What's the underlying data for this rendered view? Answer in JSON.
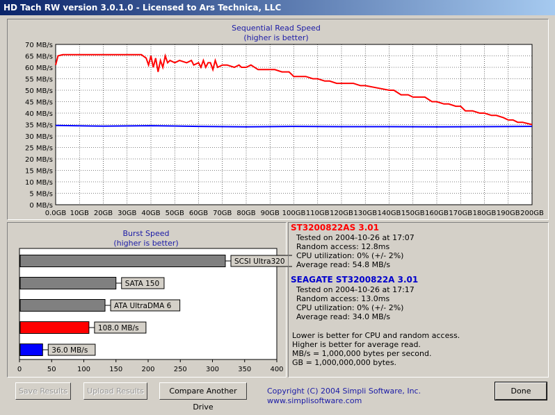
{
  "window": {
    "title": "HD Tach RW version 3.0.1.0 - Licensed to Ars Technica, LLC"
  },
  "seq_chart": {
    "title": "Sequential Read Speed",
    "subtitle": "(higher is better)",
    "y_ticks": [
      "70 MB/s",
      "65 MB/s",
      "60 MB/s",
      "55 MB/s",
      "50 MB/s",
      "45 MB/s",
      "40 MB/s",
      "35 MB/s",
      "30 MB/s",
      "25 MB/s",
      "20 MB/s",
      "15 MB/s",
      "10 MB/s",
      "5 MB/s",
      "0 MB/s"
    ],
    "x_ticks": [
      "0.0GB",
      "10GB",
      "20GB",
      "30GB",
      "40GB",
      "50GB",
      "60GB",
      "70GB",
      "80GB",
      "90GB",
      "100GB",
      "110GB",
      "120GB",
      "130GB",
      "140GB",
      "150GB",
      "160GB",
      "170GB",
      "180GB",
      "190GB",
      "200GB"
    ]
  },
  "burst_chart": {
    "title": "Burst Speed",
    "subtitle": "(higher is better)",
    "x_ticks": [
      "0",
      "50",
      "100",
      "150",
      "200",
      "250",
      "300",
      "350",
      "400"
    ]
  },
  "chart_data": [
    {
      "type": "line",
      "title": "Sequential Read Speed",
      "subtitle": "(higher is better)",
      "xlim": [
        0,
        200
      ],
      "ylim": [
        0,
        70
      ],
      "grid": true,
      "series": [
        {
          "color": "#ff0000",
          "x": [
            0,
            1,
            3,
            10,
            20,
            30,
            36,
            38,
            39,
            40,
            41,
            42,
            43,
            44,
            45,
            46,
            47,
            48,
            50,
            52,
            55,
            57,
            58,
            60,
            61,
            62,
            63,
            64,
            65,
            66,
            67,
            68,
            70,
            72,
            75,
            77,
            78,
            80,
            82,
            85,
            88,
            90,
            92,
            95,
            98,
            100,
            103,
            105,
            108,
            110,
            113,
            115,
            118,
            120,
            125,
            128,
            130,
            135,
            140,
            142,
            145,
            148,
            150,
            152,
            155,
            158,
            160,
            163,
            165,
            168,
            170,
            172,
            175,
            178,
            180,
            183,
            185,
            188,
            190,
            192,
            194,
            196,
            198,
            200
          ],
          "y": [
            61,
            65,
            65.5,
            65.5,
            65.5,
            65.5,
            65.5,
            64,
            61,
            65,
            60,
            64,
            58,
            63,
            60,
            65,
            62,
            63,
            62,
            63,
            62,
            63,
            61,
            62,
            60,
            63,
            60,
            62,
            62,
            59,
            63,
            60,
            61,
            61,
            60,
            61,
            60,
            60,
            61,
            59,
            59,
            59,
            59,
            58,
            58,
            56,
            56,
            56,
            55,
            55,
            54,
            54,
            53,
            53,
            53,
            52,
            52,
            51,
            50,
            50,
            48,
            48,
            47,
            47,
            47,
            45,
            45,
            44,
            44,
            43,
            43,
            41,
            41,
            40,
            40,
            39,
            39,
            38,
            37,
            37,
            36,
            36,
            35.5,
            35
          ]
        },
        {
          "color": "#0000ff",
          "x": [
            0,
            20,
            40,
            60,
            80,
            100,
            120,
            140,
            160,
            180,
            200
          ],
          "y": [
            34.6,
            34.3,
            34.5,
            34.2,
            34.0,
            34.2,
            34.1,
            34.1,
            34.0,
            34.1,
            34.2
          ]
        }
      ]
    },
    {
      "type": "bar",
      "title": "Burst Speed",
      "subtitle": "(higher is better)",
      "categories": [
        "SCSI Ultra320",
        "SATA 150",
        "ATA UltraDMA 6",
        "108.0 MB/s",
        "36.0 MB/s"
      ],
      "values": [
        320,
        150,
        133,
        108,
        36
      ],
      "colors": [
        "#808080",
        "#808080",
        "#808080",
        "#ff0000",
        "#0000ff"
      ],
      "xlim": [
        0,
        400
      ]
    }
  ],
  "results": [
    {
      "name": "ST3200822AS  3.01",
      "color": "#ff0000",
      "lines": [
        "Tested on 2004-10-26 at 17:07",
        "Random access: 12.8ms",
        "CPU utilization: 0% (+/- 2%)",
        "Average read: 54.8 MB/s"
      ]
    },
    {
      "name": "SEAGATE ST3200822A  3.01",
      "color": "#0000cc",
      "lines": [
        "Tested on 2004-10-26 at 17:17",
        "Random access: 13.0ms",
        "CPU utilization: 0% (+/- 2%)",
        "Average read: 34.0 MB/s"
      ]
    }
  ],
  "notes": [
    "Lower is better for CPU and random access.",
    "Higher is better for average read.",
    "MB/s = 1,000,000 bytes per second.",
    "GB = 1,000,000,000 bytes."
  ],
  "buttons": {
    "save": "Save Results",
    "upload": "Upload Results",
    "compare": "Compare Another Drive",
    "done": "Done"
  },
  "copyright": "Copyright (C) 2004 Simpli Software, Inc. www.simplisoftware.com"
}
